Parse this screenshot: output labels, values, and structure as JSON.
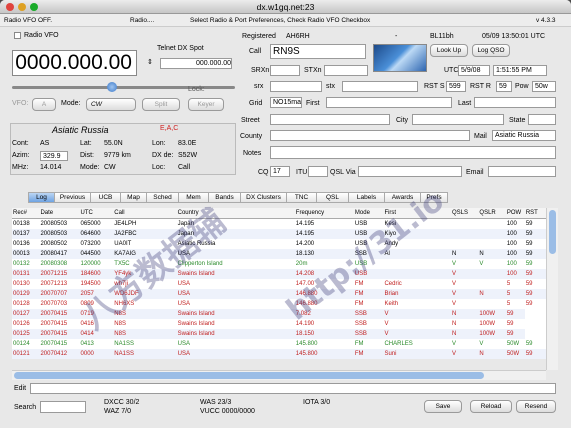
{
  "window": {
    "title": "dx.w1gq.net:23"
  },
  "statusbar": {
    "left": "Radio VFO OFF.",
    "mid": "Radio....",
    "msg": "Select  Radio & Port Preferences,  Check  Radio  VFO  Checkbox",
    "version": "v 4.3.3"
  },
  "radio": {
    "checkbox_label": "Radio VFO",
    "freq": "0000.000.00",
    "mode_label": "Mode:",
    "mode_value": "CW",
    "vfo_label": "VFO:",
    "vfo_value": "A",
    "split": "Split",
    "keyer": "Keyer",
    "lock": "Lock:",
    "telnet_label": "Telnet DX Spot",
    "telnet_value": "000.000.00"
  },
  "station": {
    "name": "Asiatic Russia",
    "flags": "E,A,C",
    "cont_l": "Cont:",
    "cont": "AS",
    "azim_l": "Azim:",
    "azim": "329.9",
    "mhz_l": "MHz:",
    "mhz": "14.014",
    "lat_l": "Lat:",
    "lat": "55.0N",
    "dist_l": "Dist:",
    "dist": "9779 km",
    "mode_l": "Mode:",
    "mode": "CW",
    "lon_l": "Lon:",
    "lon": "83.0E",
    "dxde_l": "DX de:",
    "dxde": "S52W",
    "loc_l": "Loc:",
    "loc": "Call"
  },
  "header": {
    "registered": "Registered",
    "reg_call": "AH6RH",
    "dash": "-",
    "bl": "BL11bh",
    "datetime": "05/09 13:50:01 UTC"
  },
  "qso": {
    "call_l": "Call",
    "call": "RN9S",
    "srxn_l": "SRXn",
    "stxn_l": "STXn",
    "srx_l": "srx",
    "stx_l": "stx",
    "grid_l": "Grid",
    "grid": "NO15ma",
    "first_l": "First",
    "last_l": "Last",
    "street_l": "Street",
    "city_l": "City",
    "state_l": "State",
    "county_l": "County",
    "mail_l": "Mail",
    "mail": "Asiatic Russia",
    "notes_l": "Notes",
    "cq_l": "CQ",
    "cq": "17",
    "itu_l": "ITU",
    "itu": "",
    "qsl_l": "QSL Via",
    "email_l": "Email",
    "utc_l": "UTC",
    "utc_date": "5/9/08",
    "utc_time": "1:51:55 PM",
    "rst_s_l": "RST S",
    "rst_s": "599",
    "rst_r_l": "RST R",
    "rst_r": "59",
    "pow_l": "Pow",
    "pow": "50w",
    "lookup": "Look Up",
    "logqso": "Log QSO"
  },
  "tabs": [
    "Log",
    "Previous",
    "UCB",
    "Map",
    "Sched",
    "Mem",
    "Bands",
    "DX Clusters",
    "TNC",
    "QSL",
    "Labels",
    "Awards",
    "Prefs"
  ],
  "columns": [
    "Rec#",
    "Date",
    "UTC",
    "Call",
    "Country",
    "Frequency",
    "Mode",
    "First",
    "QSLS",
    "QSLR",
    "POW",
    "RST"
  ],
  "rows": [
    [
      "00138",
      "20080503",
      "065000",
      "JE4LPH",
      "Japan",
      "14.195",
      "USB",
      "Kesi",
      "",
      "",
      "100",
      "59"
    ],
    [
      "00137",
      "20080503",
      "064600",
      "JA2FBC",
      "Japan",
      "14.195",
      "USB",
      "Kiyo",
      "",
      "",
      "100",
      "59"
    ],
    [
      "00136",
      "20080502",
      "073200",
      "UA0IT",
      "Asiatic Russia",
      "14.200",
      "USB",
      "Andy",
      "",
      "",
      "100",
      "59"
    ],
    [
      "00013",
      "20080417",
      "044500",
      "KA7AIG",
      "USA",
      "18.130",
      "SSB",
      "Al",
      "N",
      "N",
      "100",
      "59"
    ],
    [
      "00132",
      "20080308",
      "120000",
      "TX5C",
      "Clipperton Island",
      "20m",
      "USB",
      "",
      "V",
      "V",
      "100",
      "59"
    ],
    [
      "00131",
      "20071215",
      "184600",
      "YF4yk",
      "Swains Island",
      "14.208",
      "USB",
      "",
      "V",
      "",
      "100",
      "59"
    ],
    [
      "00130",
      "20071213",
      "194500",
      "wh7ji",
      "USA",
      "147.00",
      "FM",
      "Cedric",
      "V",
      "",
      "5",
      "59"
    ],
    [
      "00129",
      "20070707",
      "2057",
      "WD6JDF",
      "USA",
      "146.880",
      "FM",
      "Brian",
      "V",
      "N",
      "5",
      "59"
    ],
    [
      "00128",
      "20070703",
      "0809",
      "NH6XS",
      "USA",
      "146.880",
      "FM",
      "Keith",
      "V",
      "",
      "5",
      "59"
    ],
    [
      "00127",
      "20070415",
      "0719",
      "N8S",
      "Swains Island",
      "7.082",
      "SSB",
      "V",
      "N",
      "100W",
      "59"
    ],
    [
      "00126",
      "20070415",
      "0416",
      "N8S",
      "Swains Island",
      "14.190",
      "SSB",
      "V",
      "N",
      "100W",
      "59"
    ],
    [
      "00125",
      "20070415",
      "0414",
      "N8S",
      "Swains Island",
      "18.150",
      "SSB",
      "V",
      "N",
      "100W",
      "59"
    ],
    [
      "00124",
      "20070415",
      "0413",
      "NA1SS",
      "USA",
      "145.800",
      "FM",
      "CHARLES",
      "V",
      "V",
      "50W",
      "59"
    ],
    [
      "00121",
      "20070412",
      "0000",
      "NA1SS",
      "USA",
      "145.800",
      "FM",
      "Suni",
      "V",
      "N",
      "50W",
      "59"
    ]
  ],
  "row_colors": [
    "#000",
    "#000",
    "#000",
    "#000",
    "#2a8a2a",
    "#c02020",
    "#c02020",
    "#c02020",
    "#c02020",
    "#c02020",
    "#c02020",
    "#c02020",
    "#2a8a2a",
    "#c02020"
  ],
  "bottom": {
    "edit_l": "Edit",
    "search_l": "Search",
    "dxcc": "DXCC 30/2",
    "waz": "WAZ 7/0",
    "was": "WAS 23/3",
    "vucc": "VUCC 0000/0000",
    "iota": "IOTA 3/0",
    "save": "Save",
    "reload": "Reload",
    "resend": "Resend"
  },
  "watermark": {
    "big": "八方数据辅",
    "url": "http://31.io"
  }
}
